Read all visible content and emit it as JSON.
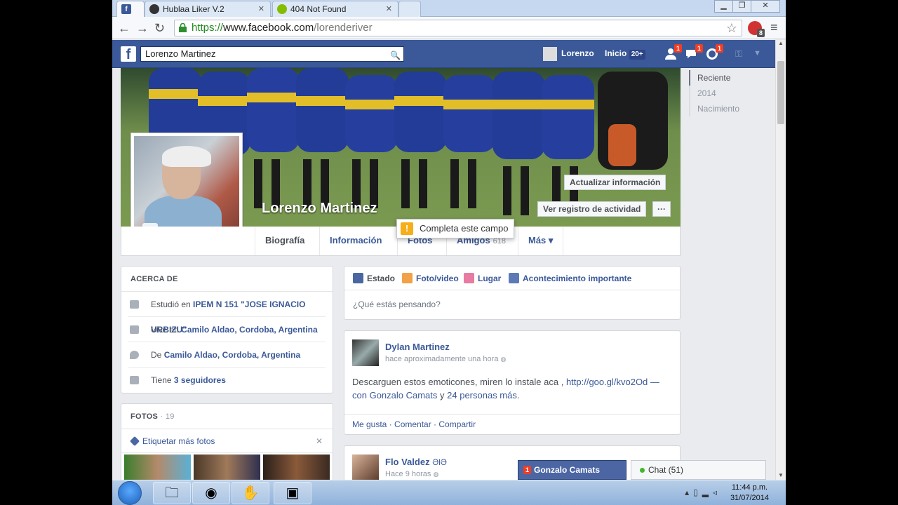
{
  "browser": {
    "tabs": [
      {
        "title": "",
        "icon": "facebook-icon"
      },
      {
        "title": "Hublaa Liker V.2",
        "icon": "hublaa-icon"
      },
      {
        "title": "404 Not Found",
        "icon": "spotify-icon"
      },
      {
        "title": "",
        "icon": "new-tab-icon"
      }
    ],
    "url_protocol": "https://",
    "url_host": "www.facebook.com",
    "url_path": "/lorenderiver",
    "extension_badge": "8"
  },
  "fbbar": {
    "search_value": "Lorenzo Martinez",
    "user_name": "Lorenzo",
    "home_label": "Inicio",
    "home_badge": "20+",
    "friend_requests_badge": "1",
    "messages_badge": "1",
    "notifications_badge": "1"
  },
  "profile": {
    "name": "Lorenzo Martinez",
    "update_info_label": "Actualizar información",
    "activity_log_label": "Ver registro de actividad",
    "more_dots": "···",
    "tooltip": "Completa este campo",
    "tabs": [
      {
        "label": "Biografía",
        "count": ""
      },
      {
        "label": "Información",
        "count": ""
      },
      {
        "label": "Fotos",
        "count": ""
      },
      {
        "label": "Amigos",
        "count": "618"
      },
      {
        "label": "Más ▾",
        "count": ""
      }
    ]
  },
  "timeline_nav": [
    "Reciente",
    "2014",
    "Nacimiento"
  ],
  "about": {
    "title": "ACERCA DE",
    "rows": [
      {
        "prefix": "Estudió en ",
        "bold": "IPEM N 151 \"JOSE IGNACIO URBIZU\"",
        "icon": "school-icon"
      },
      {
        "prefix": "Vive en ",
        "bold": "Camilo Aldao, Cordoba, Argentina",
        "icon": "home-icon"
      },
      {
        "prefix": "De ",
        "bold": "Camilo Aldao, Cordoba, Argentina",
        "icon": "location-pin-icon"
      },
      {
        "prefix": "Tiene ",
        "bold": "3 seguidores",
        "icon": "rss-icon"
      }
    ]
  },
  "photos": {
    "title": "FOTOS",
    "count": "· 19",
    "tag_label": "Etiquetar más fotos",
    "close": "✕"
  },
  "composer": {
    "tabs": [
      "Estado",
      "Foto/video",
      "Lugar",
      "Acontecimiento importante"
    ],
    "placeholder": "¿Qué estás pensando?"
  },
  "posts": [
    {
      "author": "Dylan Martinez",
      "time": "hace aproximadamente una hora",
      "text": "Descarguen estos emoticones, miren lo instale aca , ",
      "link": "http://goo.gl/kvo2Od",
      "with_prefix": " — con ",
      "with_person": "Gonzalo Camats",
      "and": " y ",
      "others": "24 personas más",
      "end": ".",
      "actions": [
        "Me gusta",
        "Comentar",
        "Compartir"
      ]
    },
    {
      "author": "Flo Valdez",
      "author_suffix": "ƏlƏ",
      "time": "Hace 9 horas"
    }
  ],
  "chat": {
    "tab_badge": "1",
    "tab_name": "Gonzalo Camats",
    "bar_label": "Chat (51)"
  },
  "taskbar": {
    "time": "11:44 p.m.",
    "date": "31/07/2014"
  }
}
